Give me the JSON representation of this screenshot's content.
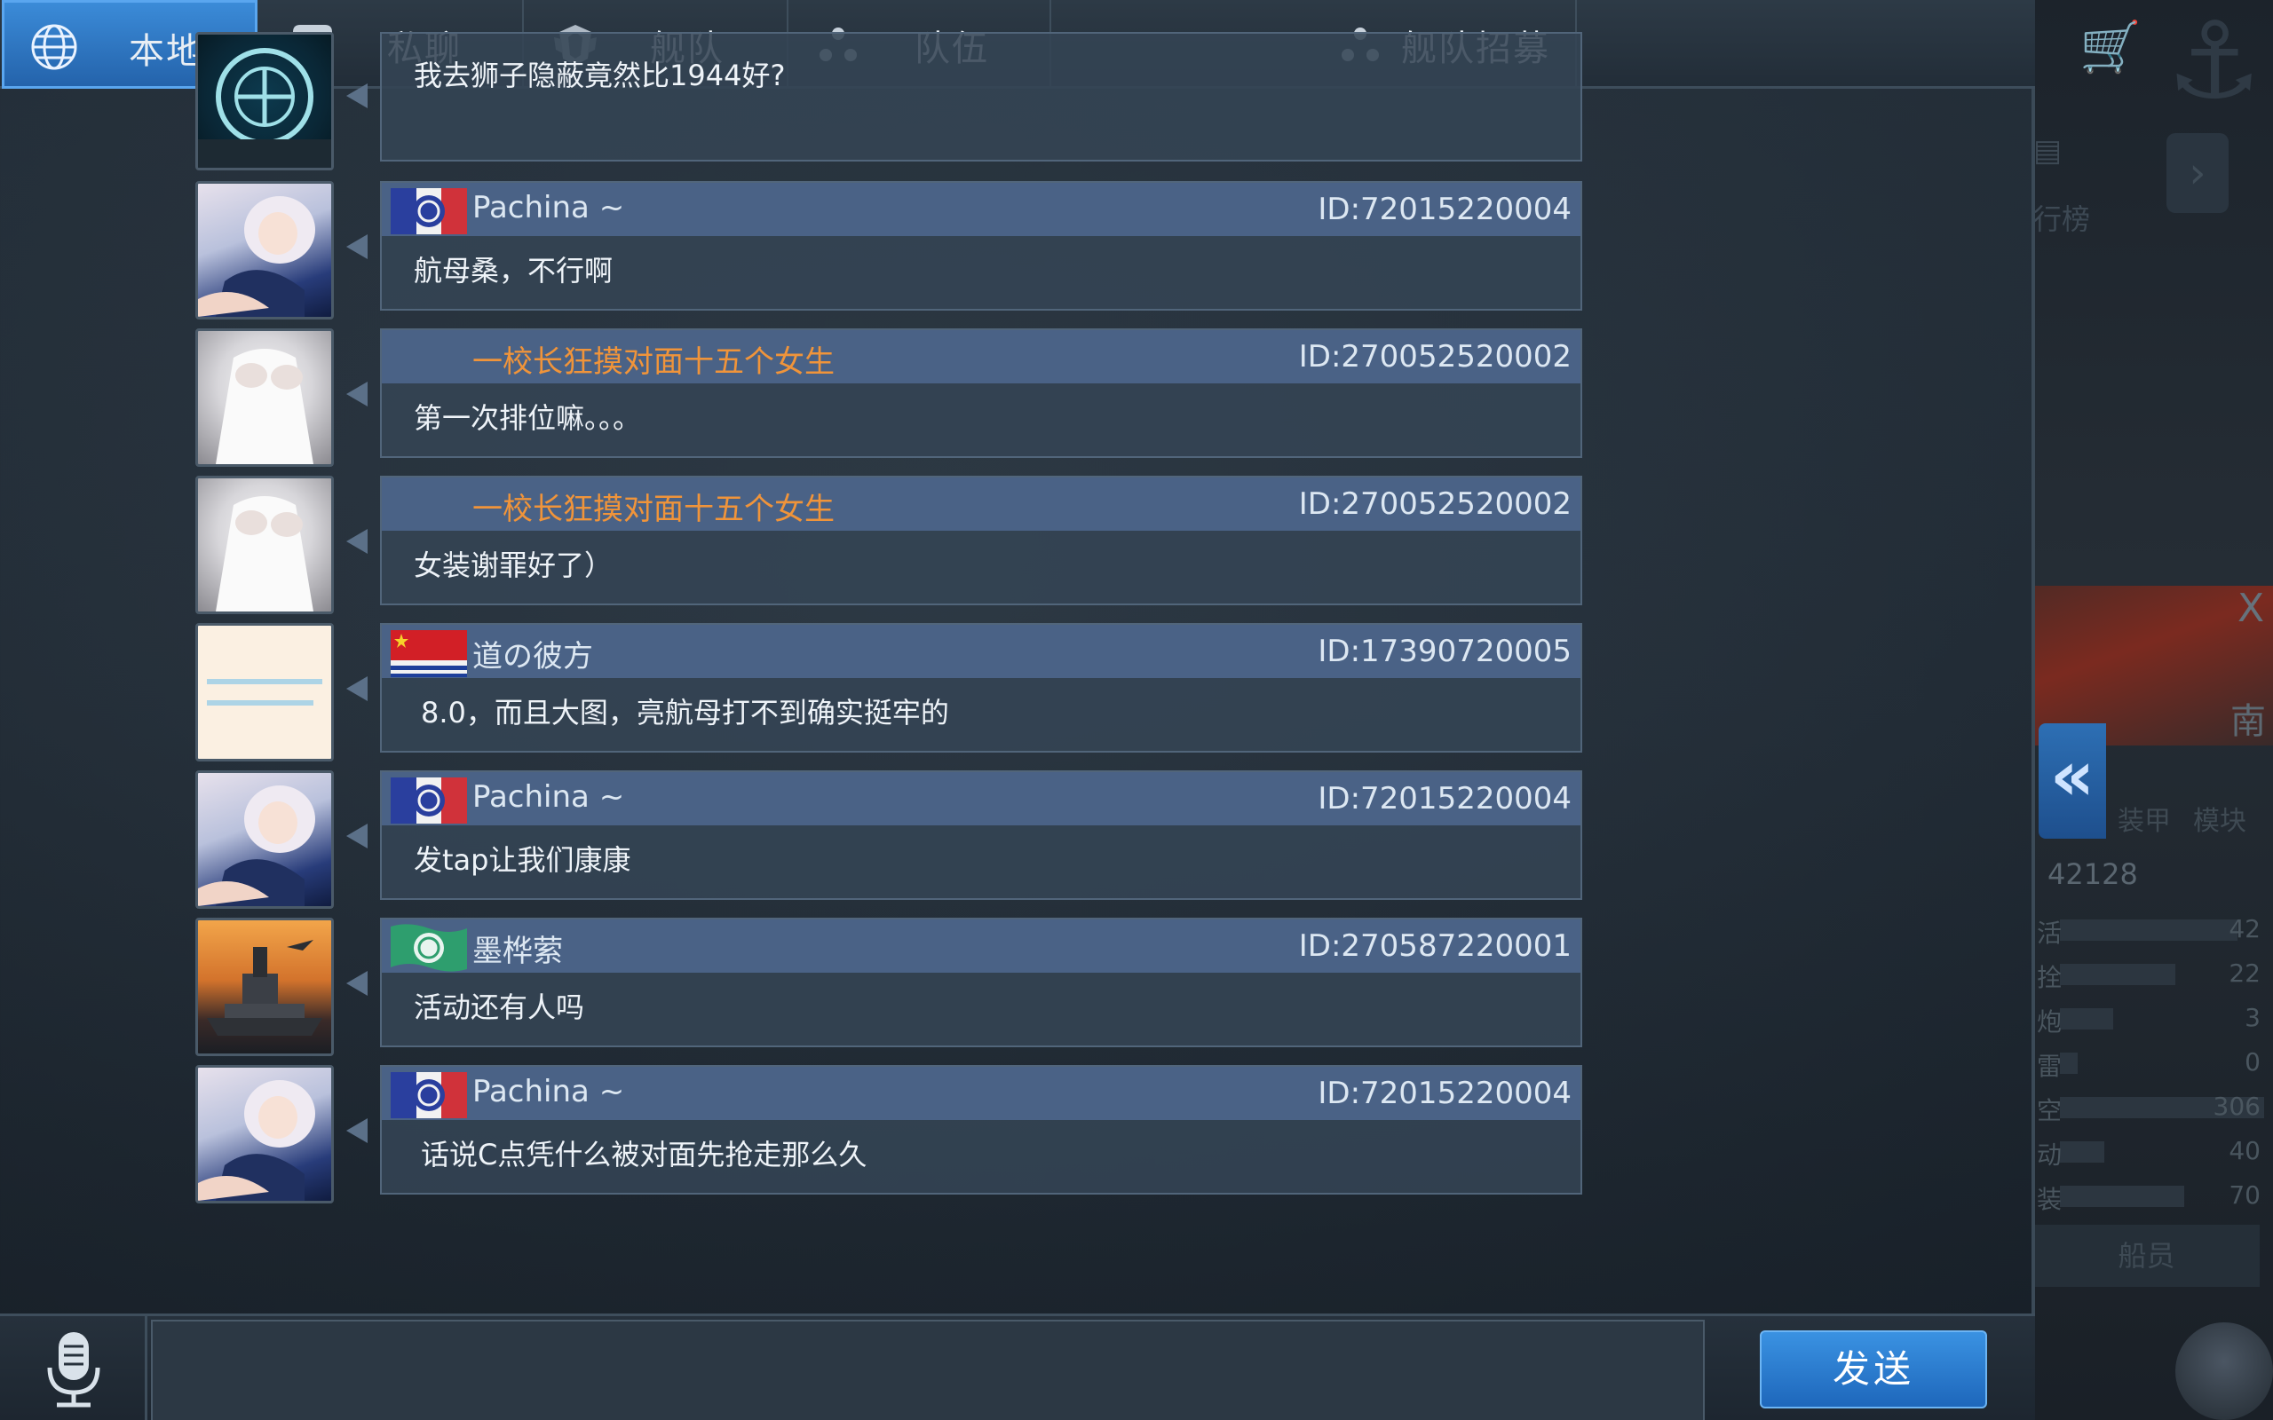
{
  "tabs": [
    {
      "label": "本地",
      "icon": "globe-icon",
      "active": true
    },
    {
      "label": "私聊",
      "icon": "chat-bubble-icon",
      "active": false
    },
    {
      "label": "舰队",
      "icon": "fleet-emblem-icon",
      "active": false
    },
    {
      "label": "队伍",
      "icon": "team-dots-icon",
      "active": false
    },
    {
      "label": "舰队招募",
      "icon": "recruit-dots-icon",
      "active": false
    }
  ],
  "messages": [
    {
      "sender": "",
      "id": "",
      "text": "我去狮子隐蔽竟然比1944好?",
      "avatar": "anchor-emblem",
      "flag": ""
    },
    {
      "sender": "Pachina ~",
      "id": "ID:72015220004",
      "text": "航母桑，不行啊",
      "avatar": "anime-girl",
      "flag": "france"
    },
    {
      "sender": "一校长狂摸对面十五个女生",
      "id": "ID:270052520002",
      "text": "第一次排位嘛。。。",
      "avatar": "white-dress",
      "flag": ""
    },
    {
      "sender": "一校长狂摸对面十五个女生",
      "id": "ID:270052520002",
      "text": "女装谢罪好了）",
      "avatar": "white-dress",
      "flag": ""
    },
    {
      "sender": "道の彼方",
      "id": "ID:17390720005",
      "text": "8.0，而且大图，亮航母打不到确实挺牢的",
      "avatar": "note-card",
      "flag": "china-navy"
    },
    {
      "sender": "Pachina ~",
      "id": "ID:72015220004",
      "text": "发tap让我们康康",
      "avatar": "anime-girl",
      "flag": "france"
    },
    {
      "sender": "墨桦萦",
      "id": "ID:270587220001",
      "text": "活动还有人吗",
      "avatar": "battleship",
      "flag": "green-emblem"
    },
    {
      "sender": "Pachina ~",
      "id": "ID:72015220004",
      "text": "话说C点凭什么被对面先抢走那么久",
      "avatar": "anime-girl",
      "flag": "france"
    }
  ],
  "input": {
    "value": "",
    "placeholder": ""
  },
  "send_label": "发送",
  "background": {
    "rank_label": "行榜",
    "south_label": "南",
    "close_label": "X",
    "tab_labels": [
      "装甲",
      "模块"
    ],
    "score": "42128",
    "stats": [
      {
        "name": "活",
        "value": "42"
      },
      {
        "name": "拴",
        "value": "22"
      },
      {
        "name": "炮",
        "value": "3"
      },
      {
        "name": "雷",
        "value": "0"
      },
      {
        "name": "空",
        "value": "306"
      },
      {
        "name": "动",
        "value": "40"
      },
      {
        "name": "装",
        "value": "70"
      }
    ],
    "crew_label": "船员"
  },
  "colors": {
    "accent": "#2f7ccc",
    "sender_highlight": "#f0943a",
    "bubble_header": "#4a6286",
    "bubble_body": "#344454"
  }
}
